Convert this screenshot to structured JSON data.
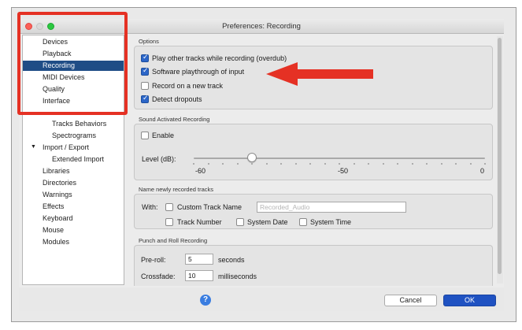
{
  "window": {
    "title": "Preferences: Recording"
  },
  "sidebar": {
    "items": [
      {
        "label": "Devices"
      },
      {
        "label": "Playback"
      },
      {
        "label": "Recording"
      },
      {
        "label": "MIDI Devices"
      },
      {
        "label": "Quality"
      },
      {
        "label": "Interface"
      },
      {
        "label": "Tracks Behaviors"
      },
      {
        "label": "Spectrograms"
      },
      {
        "label": "Import / Export"
      },
      {
        "label": "Extended Import"
      },
      {
        "label": "Libraries"
      },
      {
        "label": "Directories"
      },
      {
        "label": "Warnings"
      },
      {
        "label": "Effects"
      },
      {
        "label": "Keyboard"
      },
      {
        "label": "Mouse"
      },
      {
        "label": "Modules"
      }
    ],
    "selected": "Recording",
    "disclosure_symbol": "▼"
  },
  "options": {
    "heading": "Options",
    "checkboxes": [
      {
        "label": "Play other tracks while recording (overdub)",
        "checked": true
      },
      {
        "label": "Software playthrough of input",
        "checked": true
      },
      {
        "label": "Record on a new track",
        "checked": false
      },
      {
        "label": "Detect dropouts",
        "checked": true
      }
    ]
  },
  "sound_activated": {
    "heading": "Sound Activated Recording",
    "enable_label": "Enable",
    "enable_checked": false,
    "level_label": "Level (dB):",
    "scale": {
      "min": "-60",
      "mid": "-50",
      "max": "0"
    },
    "level_value": -56
  },
  "naming": {
    "heading": "Name newly recorded tracks",
    "with_label": "With:",
    "custom_name_label": "Custom Track Name",
    "custom_name_placeholder": "Recorded_Audio",
    "track_number_label": "Track Number",
    "system_date_label": "System Date",
    "system_time_label": "System Time"
  },
  "punch": {
    "heading": "Punch and Roll Recording",
    "preroll_label": "Pre-roll:",
    "preroll_value": "5",
    "preroll_unit": "seconds",
    "crossfade_label": "Crossfade:",
    "crossfade_value": "10",
    "crossfade_unit": "milliseconds"
  },
  "footer": {
    "help_symbol": "?",
    "cancel_label": "Cancel",
    "ok_label": "OK"
  },
  "colors": {
    "annotation_red": "#e53124",
    "selection_blue": "#1f4d86",
    "ok_blue": "#1f52c2"
  }
}
